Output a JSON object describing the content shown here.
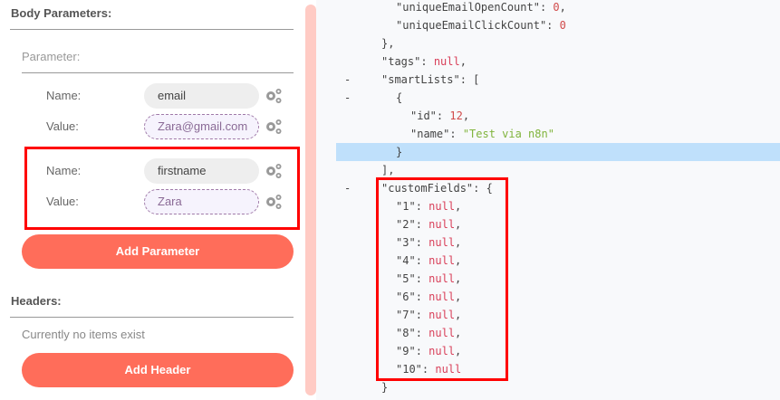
{
  "body_parameters": {
    "title": "Body Parameters:",
    "parameter_label": "Parameter:",
    "params": [
      {
        "name_label": "Name:",
        "name": "email",
        "value_label": "Value:",
        "value": "Zara@gmail.com"
      },
      {
        "name_label": "Name:",
        "name": "firstname",
        "value_label": "Value:",
        "value": "Zara"
      }
    ],
    "add_button": "Add Parameter"
  },
  "headers": {
    "title": "Headers:",
    "empty_text": "Currently no items exist",
    "add_button": "Add Header"
  },
  "colors": {
    "accent": "#ff6d5a",
    "highlight": "#bfe0fb",
    "annotation": "#ff0000"
  },
  "json_lines": [
    {
      "indent": 4,
      "key": "uniqueEmailOpenCount",
      "val": "0",
      "type": "n",
      "comma": true
    },
    {
      "indent": 4,
      "key": "uniqueEmailClickCount",
      "val": "0",
      "type": "n",
      "comma": false
    },
    {
      "indent": 3,
      "raw": "},"
    },
    {
      "indent": 3,
      "key": "tags",
      "val": "null",
      "type": "nl",
      "comma": true
    },
    {
      "indent": 3,
      "key": "smartLists",
      "raw2": "[",
      "dash": "-"
    },
    {
      "indent": 4,
      "raw": "{",
      "dash": "-"
    },
    {
      "indent": 5,
      "key": "id",
      "val": "12",
      "type": "n",
      "comma": true
    },
    {
      "indent": 5,
      "key": "name",
      "val": "\"Test via n8n\"",
      "type": "s",
      "comma": false
    },
    {
      "indent": 4,
      "raw": "}",
      "hl": true
    },
    {
      "indent": 3,
      "raw": "],"
    },
    {
      "indent": 3,
      "key": "customFields",
      "raw2": "{",
      "dash": "-"
    },
    {
      "indent": 4,
      "key": "1",
      "val": "null",
      "type": "nl",
      "comma": true
    },
    {
      "indent": 4,
      "key": "2",
      "val": "null",
      "type": "nl",
      "comma": true
    },
    {
      "indent": 4,
      "key": "3",
      "val": "null",
      "type": "nl",
      "comma": true
    },
    {
      "indent": 4,
      "key": "4",
      "val": "null",
      "type": "nl",
      "comma": true
    },
    {
      "indent": 4,
      "key": "5",
      "val": "null",
      "type": "nl",
      "comma": true
    },
    {
      "indent": 4,
      "key": "6",
      "val": "null",
      "type": "nl",
      "comma": true
    },
    {
      "indent": 4,
      "key": "7",
      "val": "null",
      "type": "nl",
      "comma": true
    },
    {
      "indent": 4,
      "key": "8",
      "val": "null",
      "type": "nl",
      "comma": true
    },
    {
      "indent": 4,
      "key": "9",
      "val": "null",
      "type": "nl",
      "comma": true
    },
    {
      "indent": 4,
      "key": "10",
      "val": "null",
      "type": "nl",
      "comma": false
    },
    {
      "indent": 3,
      "raw": "}"
    }
  ]
}
